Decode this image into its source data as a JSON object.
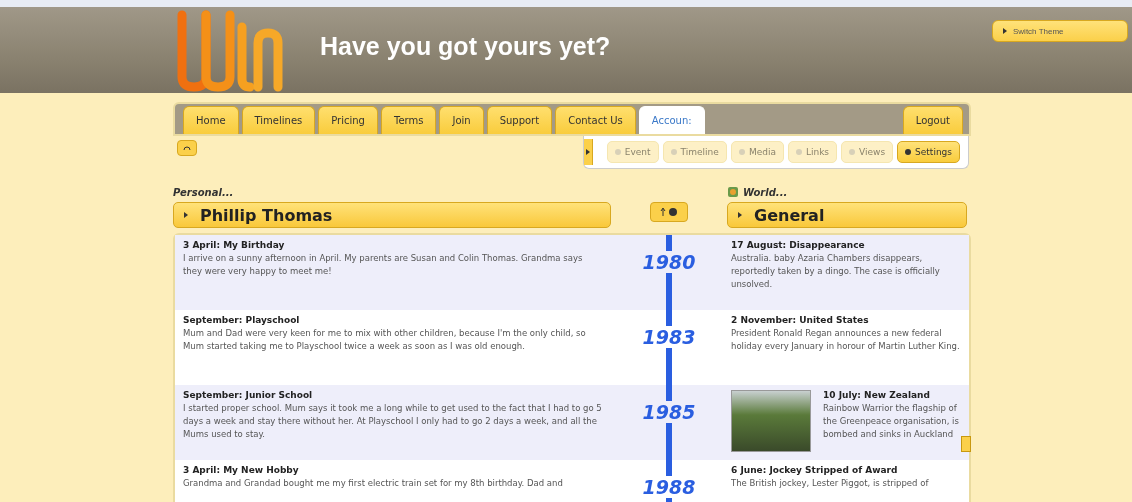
{
  "header": {
    "tagline": "Have you got yours yet?",
    "theme_button": "Switch Theme"
  },
  "tabs": [
    {
      "label": "Home",
      "selected": false
    },
    {
      "label": "Timelines",
      "selected": false
    },
    {
      "label": "Pricing",
      "selected": false
    },
    {
      "label": "Terms",
      "selected": false
    },
    {
      "label": "Join",
      "selected": false
    },
    {
      "label": "Support",
      "selected": false
    },
    {
      "label": "Contact Us",
      "selected": false
    },
    {
      "label": "Accoun:",
      "selected": true
    }
  ],
  "logout": "Logout",
  "toolbar": [
    {
      "label": "Event",
      "disabled": true,
      "selected": false
    },
    {
      "label": "Timeline",
      "disabled": true,
      "selected": false
    },
    {
      "label": "Media",
      "disabled": true,
      "selected": false
    },
    {
      "label": "Links",
      "disabled": true,
      "selected": false
    },
    {
      "label": "Views",
      "disabled": true,
      "selected": false
    },
    {
      "label": "Settings",
      "disabled": false,
      "selected": true
    }
  ],
  "personal": {
    "heading": "Personal...",
    "name": "Phillip Thomas"
  },
  "world": {
    "heading": "World...",
    "name": "General"
  },
  "rows": [
    {
      "year": "1980",
      "personal": {
        "title": "3 April: My Birthday",
        "text": "I arrive on a sunny afternoon in April. My parents are Susan and Colin Thomas. Grandma says they were very happy to meet me!"
      },
      "world": {
        "kind": "text",
        "title": "17 August: Disappearance",
        "text": "Australia. baby Azaria Chambers disappears, reportedly taken by a dingo. The case is officially unsolved."
      }
    },
    {
      "year": "1983",
      "personal": {
        "title": "September: Playschool",
        "text": "Mum and Dad were very keen for me to mix with other children, because I'm the only child, so Mum started taking me to Playschool twice a week as soon as I was old enough."
      },
      "world": {
        "kind": "text",
        "title": "2 November: United States",
        "text": "President Ronald Regan announces a new federal holiday every January in horour of Martin Luther King."
      }
    },
    {
      "year": "1985",
      "personal": {
        "title": "September: Junior School",
        "text": "I started proper school. Mum says it took me a long while to get used to the fact that I had to go 5 days a week and stay there without her. At Playschool I only had to go 2 days a week, and all the Mums used to stay."
      },
      "world": {
        "kind": "photo",
        "title": "10 July: New Zealand",
        "text": "Rainbow Warrior the flagship of the Greenpeace organisation, is bombed and sinks in Auckland"
      }
    },
    {
      "year": "1988",
      "personal": {
        "title": "3 April: My New Hobby",
        "text": "Grandma and Grandad bought me my first electric train set for my 8th birthday. Dad and"
      },
      "world": {
        "kind": "text",
        "title": "6 June: Jockey Stripped of Award",
        "text": "The British jockey, Lester Piggot, is stripped of"
      }
    }
  ]
}
